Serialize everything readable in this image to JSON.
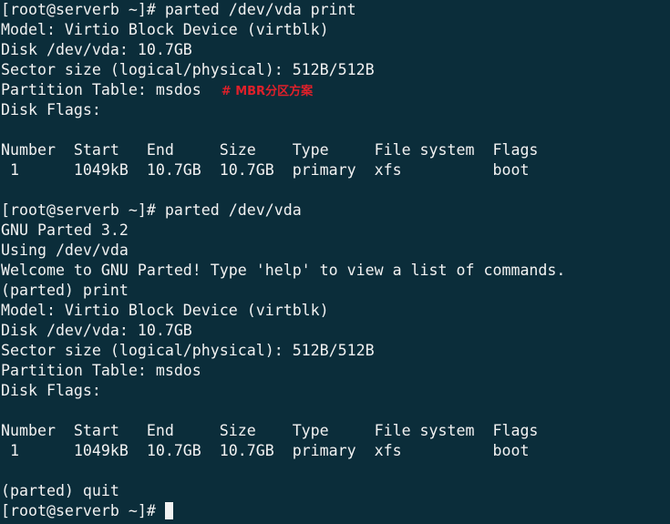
{
  "terminal": {
    "lines": [
      "[root@serverb ~]# parted /dev/vda print",
      "Model: Virtio Block Device (virtblk)",
      "Disk /dev/vda: 10.7GB",
      "Sector size (logical/physical): 512B/512B",
      "Partition Table: msdos",
      "Disk Flags:",
      "",
      "Number  Start   End     Size    Type     File system  Flags",
      " 1      1049kB  10.7GB  10.7GB  primary  xfs          boot",
      "",
      "[root@serverb ~]# parted /dev/vda",
      "GNU Parted 3.2",
      "Using /dev/vda",
      "Welcome to GNU Parted! Type 'help' to view a list of commands.",
      "(parted) print",
      "Model: Virtio Block Device (virtblk)",
      "Disk /dev/vda: 10.7GB",
      "Sector size (logical/physical): 512B/512B",
      "Partition Table: msdos",
      "Disk Flags:",
      "",
      "Number  Start   End     Size    Type     File system  Flags",
      " 1      1049kB  10.7GB  10.7GB  primary  xfs          boot",
      "",
      "(parted) quit",
      "[root@serverb ~]# "
    ],
    "annotation": "# MBR分区方案",
    "colors": {
      "background": "#0b2d3a",
      "foreground": "#f2f2f2",
      "annotation": "#e0202a"
    }
  }
}
